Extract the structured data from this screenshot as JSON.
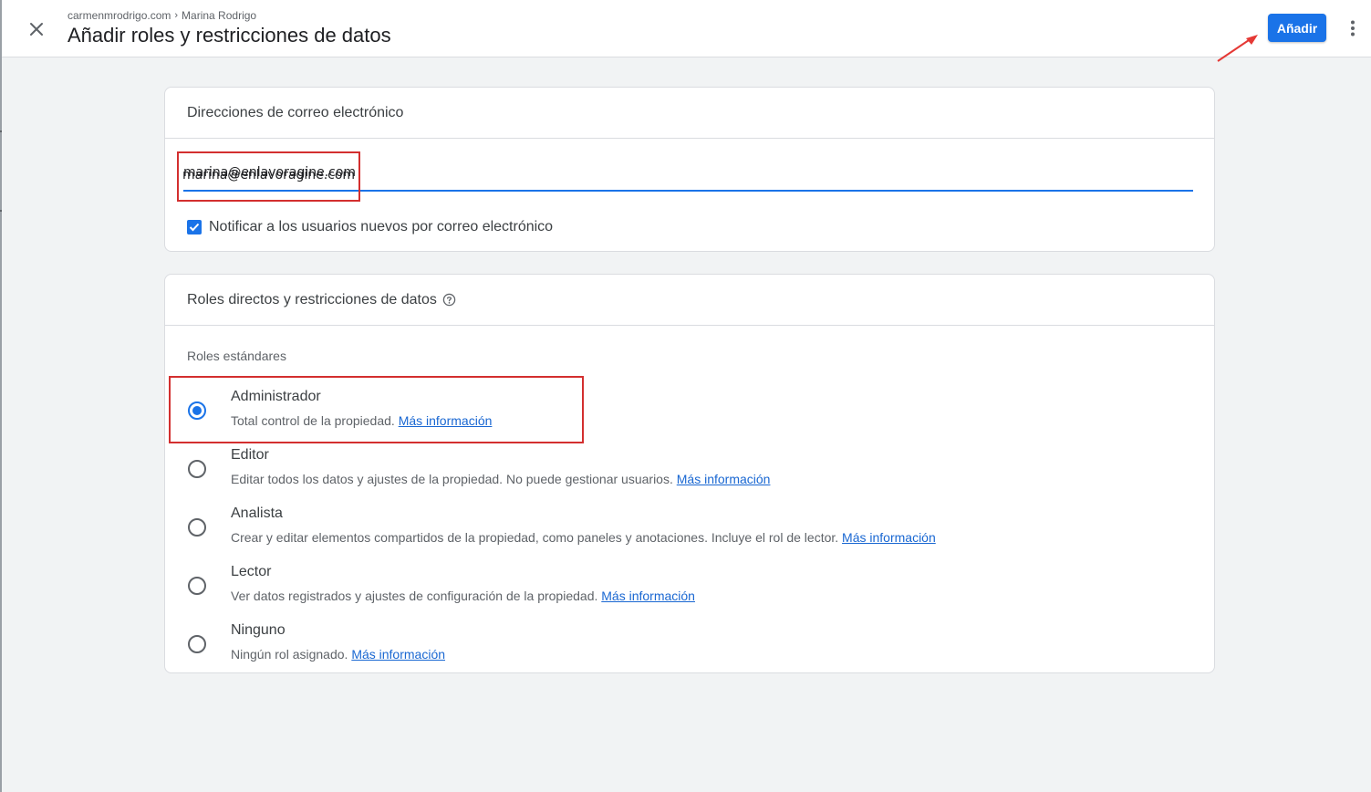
{
  "header": {
    "breadcrumb": [
      "carmenmrodrigo.com",
      "Marina Rodrigo"
    ],
    "title": "Añadir roles y restricciones de datos",
    "add_label": "Añadir"
  },
  "email_card": {
    "title": "Direcciones de correo electrónico",
    "email_value": "marina@enlavoragine.com",
    "notify_label": "Notificar a los usuarios nuevos por correo electrónico",
    "notify_checked": true
  },
  "roles_card": {
    "title": "Roles directos y restricciones de datos",
    "section_label": "Roles estándares",
    "link_label": "Más información",
    "roles": [
      {
        "name": "Administrador",
        "desc": "Total control de la propiedad.",
        "selected": true
      },
      {
        "name": "Editor",
        "desc": "Editar todos los datos y ajustes de la propiedad. No puede gestionar usuarios.",
        "selected": false
      },
      {
        "name": "Analista",
        "desc": "Crear y editar elementos compartidos de la propiedad, como paneles y anotaciones. Incluye el rol de lector.",
        "selected": false
      },
      {
        "name": "Lector",
        "desc": "Ver datos registrados y ajustes de configuración de la propiedad.",
        "selected": false
      },
      {
        "name": "Ninguno",
        "desc": "Ningún rol asignado.",
        "selected": false
      }
    ]
  },
  "colors": {
    "accent": "#1a73e8",
    "annotation": "#d32f2f",
    "link": "#1967d2"
  },
  "icons": [
    "close-icon",
    "more-vert-icon",
    "help-circle-icon",
    "checkmark-icon",
    "arrow-annotation-icon"
  ]
}
